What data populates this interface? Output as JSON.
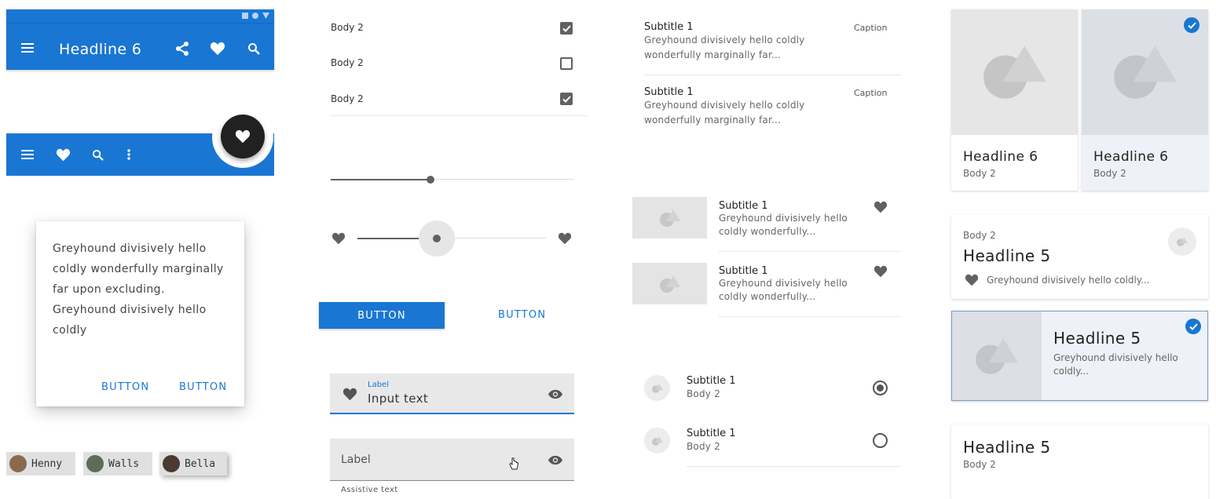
{
  "colors": {
    "primary": "#1976d2",
    "fab": "#212121",
    "surface": "#ffffff",
    "placeholder": "#e4e4e4",
    "selected_surface": "#eef1f7"
  },
  "top_app_bar": {
    "title": "Headline 6",
    "icons": [
      "menu-icon",
      "share-icon",
      "heart-icon",
      "search-icon"
    ],
    "status_icons": [
      "wifi-square-icon",
      "circle-icon",
      "triangle-down-icon"
    ]
  },
  "bottom_app_bar": {
    "icons": [
      "menu-icon",
      "heart-icon",
      "search-icon",
      "more-vert-icon"
    ],
    "fab_icon": "heart-icon"
  },
  "dialog": {
    "text": "Greyhound divisively hello coldly wonderfully marginally far upon excluding. Greyhound divisively hello coldly",
    "button1": "BUTTON",
    "button2": "BUTTON"
  },
  "chips": [
    {
      "label": "Henny",
      "avatar": "#8a6a4d"
    },
    {
      "label": "Walls",
      "avatar": "#5f6b5a"
    },
    {
      "label": "Bella",
      "avatar": "#4a3a32"
    }
  ],
  "checkbox_list": [
    {
      "label": "Body 2",
      "checked": true
    },
    {
      "label": "Body 2",
      "checked": false
    },
    {
      "label": "Body 2",
      "checked": true
    }
  ],
  "slider1": {
    "value": 0.4
  },
  "slider2": {
    "value": 0.42,
    "icon_start": "heart-icon",
    "icon_end": "heart-icon"
  },
  "buttons": {
    "contained": "BUTTON",
    "text": "BUTTON"
  },
  "text_field_filled": {
    "label": "Label",
    "value": "Input text",
    "leading_icon": "heart-icon",
    "trailing_icon": "eye-icon"
  },
  "text_field_empty": {
    "label": "Label",
    "assistive": "Assistive text",
    "trailing_icon": "eye-icon"
  },
  "two_line_list": [
    {
      "title": "Subtitle 1",
      "body": "Greyhound divisively hello coldly wonderfully marginally far...",
      "caption": "Caption"
    },
    {
      "title": "Subtitle 1",
      "body": "Greyhound divisively hello coldly wonderfully marginally far...",
      "caption": "Caption"
    }
  ],
  "image_list": [
    {
      "title": "Subtitle 1",
      "body": "Greyhound divisively hello coldly wonderfully..."
    },
    {
      "title": "Subtitle 1",
      "body": "Greyhound divisively hello coldly wonderfully..."
    }
  ],
  "radio_list": [
    {
      "title": "Subtitle 1",
      "body": "Body 2",
      "selected": true
    },
    {
      "title": "Subtitle 1",
      "body": "Body 2",
      "selected": false
    }
  ],
  "cards": {
    "grid": [
      {
        "headline": "Headline 6",
        "body": "Body 2",
        "selected": false
      },
      {
        "headline": "Headline 6",
        "body": "Body 2",
        "selected": true
      }
    ],
    "info": {
      "overline": "Body 2",
      "headline": "Headline 5",
      "text": "Greyhound divisively hello coldly..."
    },
    "horizontal": {
      "headline": "Headline 5",
      "text": "Greyhound divisively hello coldly...",
      "selected": true
    },
    "simple": {
      "headline": "Headline 5",
      "body": "Body 2"
    }
  }
}
